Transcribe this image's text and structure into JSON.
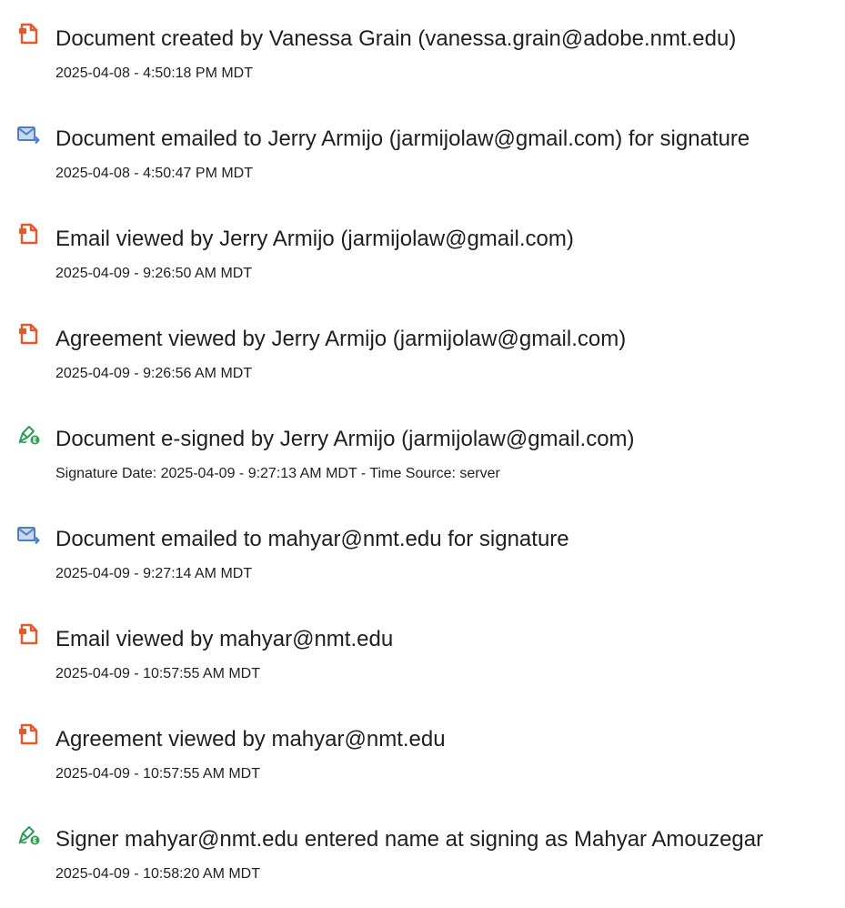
{
  "events": [
    {
      "icon": "document-icon",
      "title": "Document created by Vanessa Grain (vanessa.grain@adobe.nmt.edu)",
      "meta": "2025-04-08 - 4:50:18 PM MDT"
    },
    {
      "icon": "email-icon",
      "title": "Document emailed to Jerry Armijo (jarmijolaw@gmail.com) for signature",
      "meta": "2025-04-08 - 4:50:47 PM MDT"
    },
    {
      "icon": "document-icon",
      "title": "Email viewed by Jerry Armijo (jarmijolaw@gmail.com)",
      "meta": "2025-04-09 - 9:26:50 AM MDT"
    },
    {
      "icon": "document-icon",
      "title": "Agreement viewed by Jerry Armijo (jarmijolaw@gmail.com)",
      "meta": "2025-04-09 - 9:26:56 AM MDT"
    },
    {
      "icon": "e-sign-pen-icon",
      "title": "Document e-signed by Jerry Armijo (jarmijolaw@gmail.com)",
      "meta": "Signature Date: 2025-04-09 - 9:27:13 AM MDT - Time Source: server"
    },
    {
      "icon": "email-icon",
      "title": "Document emailed to mahyar@nmt.edu for signature",
      "meta": "2025-04-09 - 9:27:14 AM MDT"
    },
    {
      "icon": "document-icon",
      "title": "Email viewed by mahyar@nmt.edu",
      "meta": "2025-04-09 - 10:57:55 AM MDT"
    },
    {
      "icon": "document-icon",
      "title": "Agreement viewed by mahyar@nmt.edu",
      "meta": "2025-04-09 - 10:57:55 AM MDT"
    },
    {
      "icon": "e-sign-pen-icon",
      "title": "Signer mahyar@nmt.edu entered name at signing as Mahyar Amouzegar",
      "meta": "2025-04-09 - 10:58:20 AM MDT"
    }
  ],
  "colors": {
    "document_icon": "#e8562a",
    "email_icon_body": "#c9d7ec",
    "email_icon_stroke": "#4d7fc4",
    "pen_icon": "#2e9e56",
    "text": "#1f1f1f"
  }
}
